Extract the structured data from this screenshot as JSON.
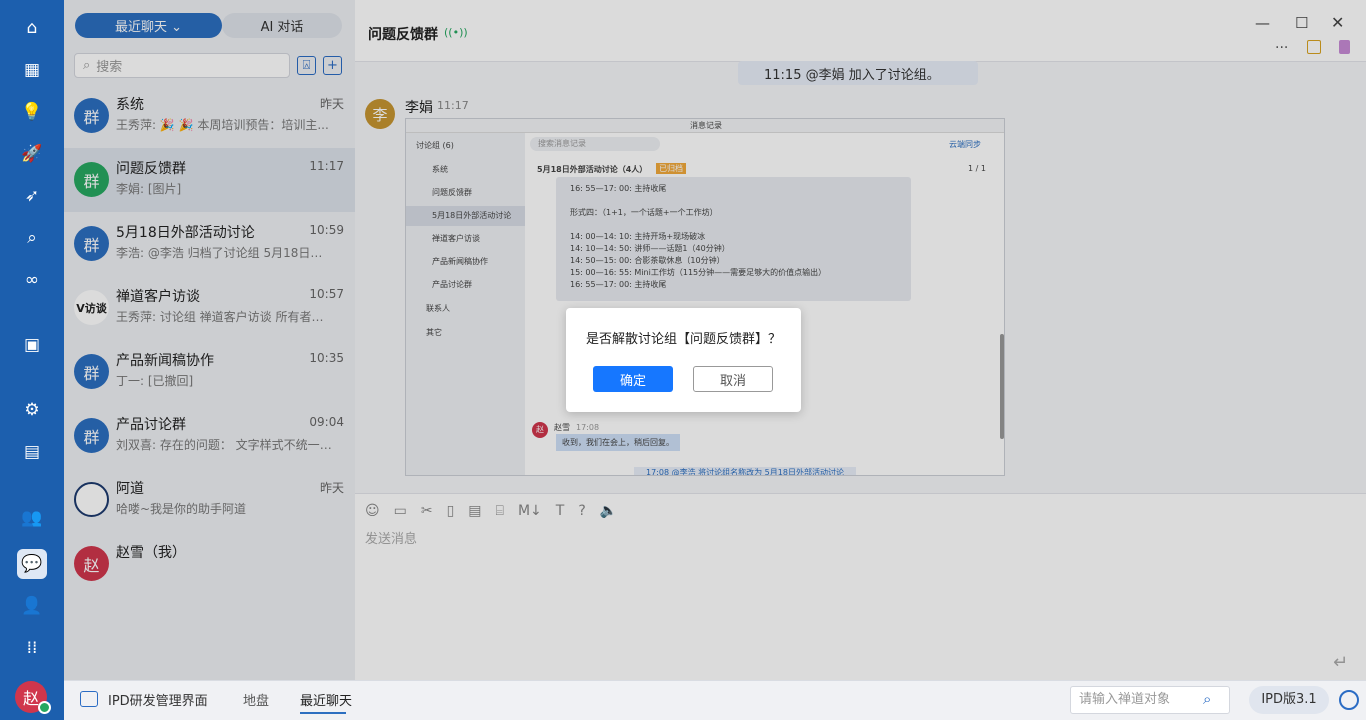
{
  "rail": {
    "avatar_text": "赵"
  },
  "list": {
    "tab_recent": "最近聊天 ⌄",
    "tab_ai": "AI 对话",
    "search_placeholder": "搜索",
    "items": [
      {
        "title": "系统",
        "time": "昨天",
        "sub": "王秀萍: 🎉 🎉 本周培训预告：培训主...",
        "avatar": "群",
        "color": "#2c6fc0"
      },
      {
        "title": "问题反馈群",
        "time": "11:17",
        "sub": "李娟: [图片]",
        "avatar": "群",
        "color": "#27a861"
      },
      {
        "title": "5月18日外部活动讨论",
        "time": "10:59",
        "sub": "李浩: @李浩 归档了讨论组 5月18日外部...",
        "avatar": "群",
        "color": "#2c6fc0"
      },
      {
        "title": "禅道客户访谈",
        "time": "10:57",
        "sub": "王秀萍: 讨论组 禅道客户访谈 所有者更...",
        "avatar": "V访谈",
        "color": "#ffffff"
      },
      {
        "title": "产品新闻稿协作",
        "time": "10:35",
        "sub": "丁一: [已撤回]",
        "avatar": "群",
        "color": "#2c6fc0"
      },
      {
        "title": "产品讨论群",
        "time": "09:04",
        "sub": "刘双喜: 存在的问题： 文字样式不统一；...",
        "avatar": "群",
        "color": "#2c6fc0"
      },
      {
        "title": "阿道",
        "time": "昨天",
        "sub": "哈喽~我是你的助手阿道",
        "avatar": "",
        "color": "#ffffff"
      },
      {
        "title": "赵雪（我）",
        "time": "",
        "sub": "",
        "avatar": "赵",
        "color": "#d0364c"
      }
    ]
  },
  "chat": {
    "title": "问题反馈群",
    "notice": "11:15 @李娟 加入了讨论组。",
    "sender": "李娟",
    "sender_avatar": "李",
    "msg_time": "11:17",
    "input_placeholder": "发送消息"
  },
  "embedded": {
    "window_title": "消息记录",
    "search_placeholder": "搜索消息记录",
    "cloud_sync": "云端同步",
    "group_header": "讨论组 (6)",
    "groups": [
      "系统",
      "问题反馈群",
      "5月18日外部活动讨论",
      "禅道客户访谈",
      "产品新闻稿协作",
      "产品讨论群"
    ],
    "contacts": "联系人",
    "others": "其它",
    "conv_title": "5月18日外部活动讨论（4人）",
    "archived_badge": "已归档",
    "pager": "1 / 1",
    "lines": [
      "16: 55—17: 00: 主持收尾",
      "",
      "形式四：（1+1，一个话题+一个工作坊）",
      "",
      "14: 00—14: 10: 主持开场+现场破冰",
      "14: 10—14: 50: 讲师——话题1（40分钟）",
      "14: 50—15: 00: 合影茶歇休息（10分钟）",
      "15: 00—16: 55: Mini工作坊（115分钟——需要足够大的价值点输出）",
      "16: 55—17: 00: 主持收尾"
    ],
    "reply_name": "赵雪",
    "reply_time": "17:08",
    "reply_text": "收到，我们在会上，稍后回复。",
    "footer_notice": "17:08 @李浩 将讨论组名称改为 5月18日外部活动讨论"
  },
  "dialog": {
    "message": "是否解散讨论组【问题反馈群】？",
    "confirm": "确定",
    "cancel": "取消"
  },
  "bottom": {
    "app_name": "IPD研发管理界面",
    "crumb_map": "地盘",
    "crumb_chat": "最近聊天",
    "search_placeholder": "请输入禅道对象",
    "version": "IPD版3.1"
  },
  "colors": {
    "rail": "#1c5fae",
    "primary": "#1677ff",
    "selected": "#dde2ea"
  }
}
